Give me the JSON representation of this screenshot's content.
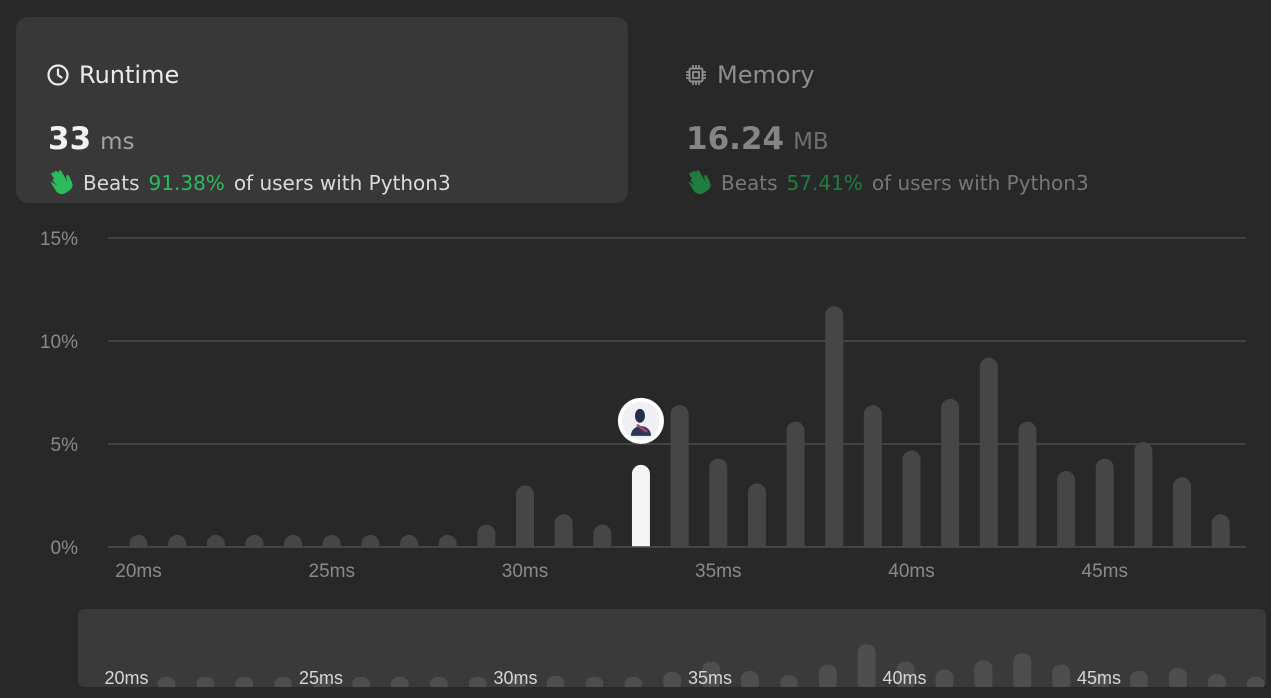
{
  "runtime": {
    "title": "Runtime",
    "value": "33",
    "unit": "ms",
    "beats_word": "Beats",
    "beats_pct": "91.38%",
    "beats_suffix": "of users with Python3"
  },
  "memory": {
    "title": "Memory",
    "value": "16.24",
    "unit": "MB",
    "beats_word": "Beats",
    "beats_pct": "57.41%",
    "beats_suffix": "of users with Python3"
  },
  "colors": {
    "accent_green": "#2cbb5d",
    "bar": "#464646",
    "bar_highlight": "#f5f5f5",
    "grid": "#4a4a4a",
    "card_bg": "#383838",
    "page_bg": "#282828"
  },
  "chart_data": {
    "type": "bar",
    "x_label_unit": "ms",
    "xlim": [
      19.5,
      48.5
    ],
    "ylim": [
      0,
      15
    ],
    "y_ticks": [
      0,
      5,
      10,
      15
    ],
    "y_tick_labels": [
      "0%",
      "5%",
      "10%",
      "15%"
    ],
    "x_ticks": [
      20,
      25,
      30,
      35,
      40,
      45
    ],
    "x_tick_labels": [
      "20ms",
      "25ms",
      "30ms",
      "35ms",
      "40ms",
      "45ms"
    ],
    "grid": true,
    "highlight_x": 33,
    "x": [
      20,
      21,
      22,
      23,
      24,
      25,
      26,
      27,
      28,
      29,
      30,
      31,
      32,
      33,
      34,
      35,
      36,
      37,
      38,
      39,
      40,
      41,
      42,
      43,
      44,
      45,
      46,
      47,
      48
    ],
    "values": [
      0.2,
      0.2,
      0.2,
      0.2,
      0.2,
      0.2,
      0.2,
      0.2,
      0.2,
      0.7,
      2.6,
      1.2,
      0.7,
      3.6,
      6.5,
      3.9,
      2.7,
      5.7,
      11.3,
      6.5,
      4.3,
      6.8,
      8.8,
      5.7,
      3.3,
      3.9,
      4.7,
      3.0,
      1.2
    ]
  }
}
